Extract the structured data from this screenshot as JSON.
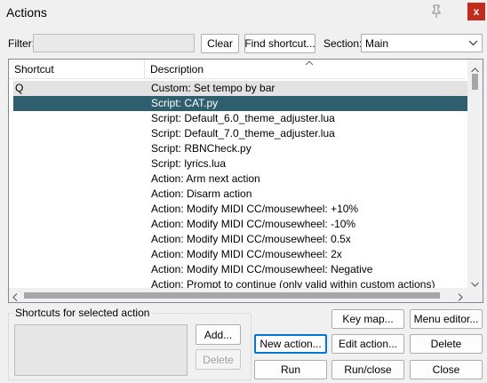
{
  "window": {
    "title": "Actions",
    "close_glyph": "x"
  },
  "filter": {
    "label": "Filter:",
    "value": ""
  },
  "buttons": {
    "clear": "Clear",
    "find_shortcut": "Find shortcut...",
    "key_map": "Key map...",
    "menu_editor": "Menu editor...",
    "add": "Add...",
    "delete_shortcut": "Delete",
    "new_action": "New action...",
    "edit_action": "Edit action...",
    "delete_action": "Delete",
    "run": "Run",
    "run_close": "Run/close",
    "close": "Close"
  },
  "section": {
    "label": "Section:",
    "value": "Main"
  },
  "table": {
    "columns": [
      "Shortcut",
      "Description"
    ],
    "rows": [
      {
        "shortcut": "Q",
        "description": "Custom: Set tempo by bar"
      },
      {
        "shortcut": "",
        "description": "Script: CAT.py",
        "selected": true
      },
      {
        "shortcut": "",
        "description": "Script: Default_6.0_theme_adjuster.lua"
      },
      {
        "shortcut": "",
        "description": "Script: Default_7.0_theme_adjuster.lua"
      },
      {
        "shortcut": "",
        "description": "Script: RBNCheck.py"
      },
      {
        "shortcut": "",
        "description": "Script: lyrics.lua"
      },
      {
        "shortcut": "",
        "description": "Action: Arm next action"
      },
      {
        "shortcut": "",
        "description": "Action: Disarm action"
      },
      {
        "shortcut": "",
        "description": "Action: Modify MIDI CC/mousewheel: +10%"
      },
      {
        "shortcut": "",
        "description": "Action: Modify MIDI CC/mousewheel: -10%"
      },
      {
        "shortcut": "",
        "description": "Action: Modify MIDI CC/mousewheel: 0.5x"
      },
      {
        "shortcut": "",
        "description": "Action: Modify MIDI CC/mousewheel: 2x"
      },
      {
        "shortcut": "",
        "description": "Action: Modify MIDI CC/mousewheel: Negative"
      },
      {
        "shortcut": "",
        "description": "Action: Prompt to continue (only valid within custom actions)"
      }
    ]
  },
  "shortcuts_group": {
    "label": "Shortcuts for selected action"
  },
  "colors": {
    "selected_row": "#2f5f6e",
    "stripe_row": "#e2e2e2",
    "close_button": "#c42b1c",
    "focus": "#0078d7"
  },
  "icons": {
    "pin": "pin-icon",
    "sort": "sort-up-icon",
    "dropdown": "chevron-down-icon"
  }
}
